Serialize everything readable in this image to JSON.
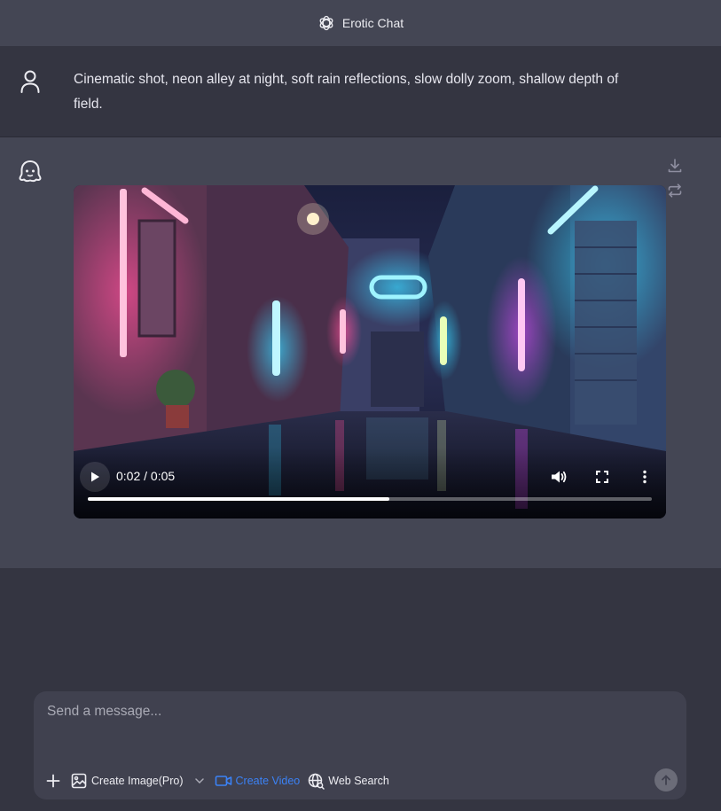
{
  "header": {
    "title": "Erotic Chat",
    "logo_icon": "openai-logo-icon"
  },
  "conversation": {
    "user_message": "Cinematic shot, neon alley at night, soft rain reflections, slow dolly zoom, shallow depth of field.",
    "user_avatar_icon": "user-icon",
    "bot_avatar_icon": "ghost-icon",
    "actions": {
      "download_icon": "download-icon",
      "regenerate_icon": "repeat-icon"
    },
    "video": {
      "current_time": "0:02",
      "duration": "0:05",
      "time_display": "0:02 / 0:05",
      "progress": 0.535,
      "icons": [
        "play-icon",
        "volume-icon",
        "fullscreen-icon",
        "more-vertical-icon"
      ]
    }
  },
  "composer": {
    "placeholder": "Send a message...",
    "tools": {
      "create_image": "Create Image(Pro)",
      "create_video": "Create Video",
      "web_search": "Web Search"
    },
    "accent_color": "#3b82f6"
  },
  "colors": {
    "background": "#343541",
    "header": "#444654",
    "bot_row": "#444654",
    "composer": "#40414f"
  }
}
